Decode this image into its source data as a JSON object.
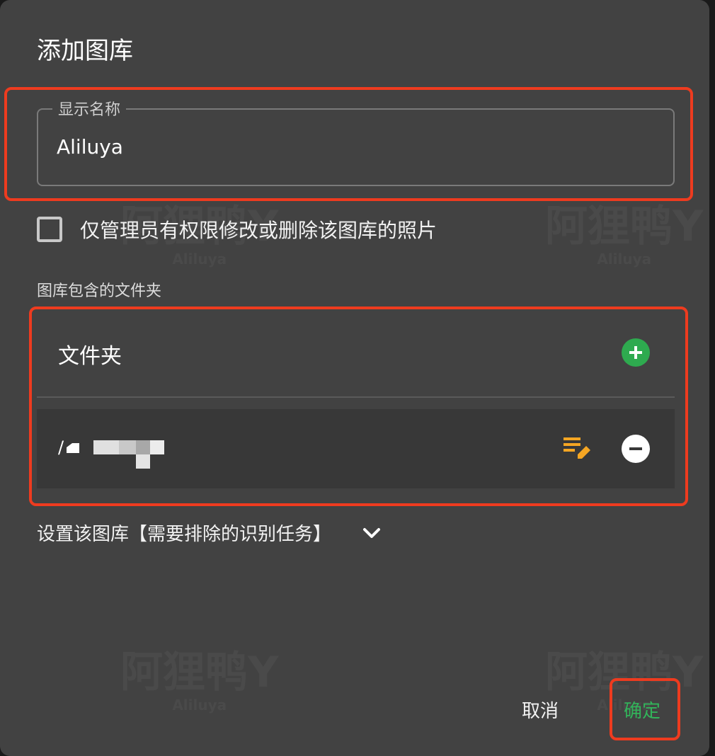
{
  "dialog": {
    "title": "添加图库"
  },
  "display_name": {
    "label": "显示名称",
    "value": "Aliluya"
  },
  "admin_only": {
    "label": "仅管理员有权限修改或删除该图库的照片",
    "checked": false
  },
  "folders": {
    "section_label": "图库包含的文件夹",
    "header_label": "文件夹",
    "items": [
      {
        "path_prefix": "/"
      }
    ]
  },
  "exclude_tasks": {
    "label": "设置该图库【需要排除的识别任务】"
  },
  "actions": {
    "cancel": "取消",
    "confirm": "确定"
  },
  "watermark": {
    "text": "阿狸鸭Y",
    "subtext": "Aliluya"
  },
  "colors": {
    "dialog_bg": "#424242",
    "accent_green": "#2eaa4f",
    "edit_orange": "#f5a623",
    "highlight_red": "#ee3b1f"
  },
  "icons": {
    "add": "plus-circle-icon",
    "edit": "edit-note-icon",
    "remove": "minus-circle-icon",
    "expand": "chevron-down-icon"
  }
}
